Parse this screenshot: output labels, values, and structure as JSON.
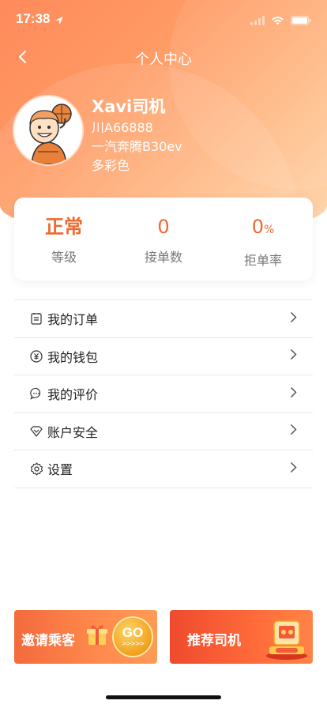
{
  "status": {
    "time": "17:38"
  },
  "nav": {
    "title": "个人中心"
  },
  "profile": {
    "name": "Xavi司机",
    "plate": "川A66888",
    "car_model": "一汽奔腾B30ev",
    "car_color": "多彩色"
  },
  "stats": [
    {
      "value": "正常",
      "label": "等级"
    },
    {
      "value": "0",
      "label": "接单数"
    },
    {
      "value": "0",
      "unit": "%",
      "label": "拒单率"
    }
  ],
  "menu": [
    {
      "label": "我的订单",
      "icon": "order-icon"
    },
    {
      "label": "我的钱包",
      "icon": "wallet-icon"
    },
    {
      "label": "我的评价",
      "icon": "comment-icon"
    },
    {
      "label": "账户安全",
      "icon": "shield-icon"
    },
    {
      "label": "设置",
      "icon": "gear-icon"
    }
  ],
  "banners": {
    "invite": {
      "label": "邀请乘客",
      "go": "GO",
      "arrows": ">>>>>"
    },
    "recommend": {
      "label": "推荐司机"
    }
  },
  "colors": {
    "accent": "#ef6a2e",
    "gradient_start": "#ff8a5b",
    "gradient_end": "#ffd7b0"
  }
}
